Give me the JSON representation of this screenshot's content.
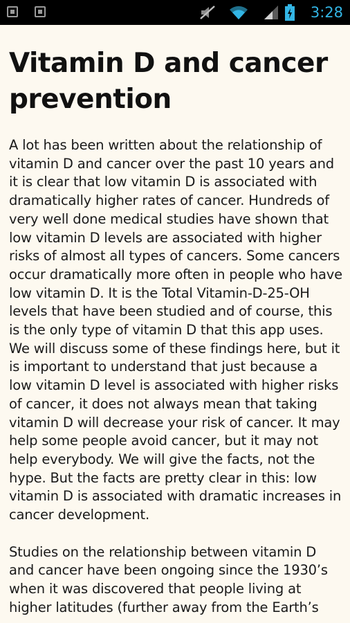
{
  "status_bar": {
    "time": "3:28",
    "icons": [
      "notification-icon",
      "notification-icon",
      "mute-icon",
      "wifi-icon",
      "signal-icon",
      "battery-icon"
    ],
    "accent_color": "#33b5e5"
  },
  "article": {
    "title": "Vitamin D and cancer prevention",
    "paragraphs": [
      "A lot has been written about the relationship of vitamin D and cancer over the past 10 years and it is clear that low vitamin D is associated with dramatically higher rates of cancer. Hundreds of very well done medical studies have shown that low vitamin D levels are associated with higher risks of almost all types of cancers. Some cancers occur dramatically more often in people who have low vitamin D. It is the Total Vitamin-D-25-OH levels that have been studied and of course, this is the only type of vitamin D that this app uses. We will discuss some of these findings here, but it is important to understand that just because a low vitamin D level is associated with higher risks of cancer, it does not always mean that taking vitamin D will decrease your risk of cancer. It may help some people avoid cancer, but it may not help everybody. We will give the facts, not the hype. But the facts are pretty clear in this: low vitamin D is associated with dramatic increases in cancer development.",
      "Studies on the relationship between vitamin D and cancer have been ongoing since the 1930’s when it was discovered that people living at higher latitudes (further away from the Earth’s"
    ]
  }
}
